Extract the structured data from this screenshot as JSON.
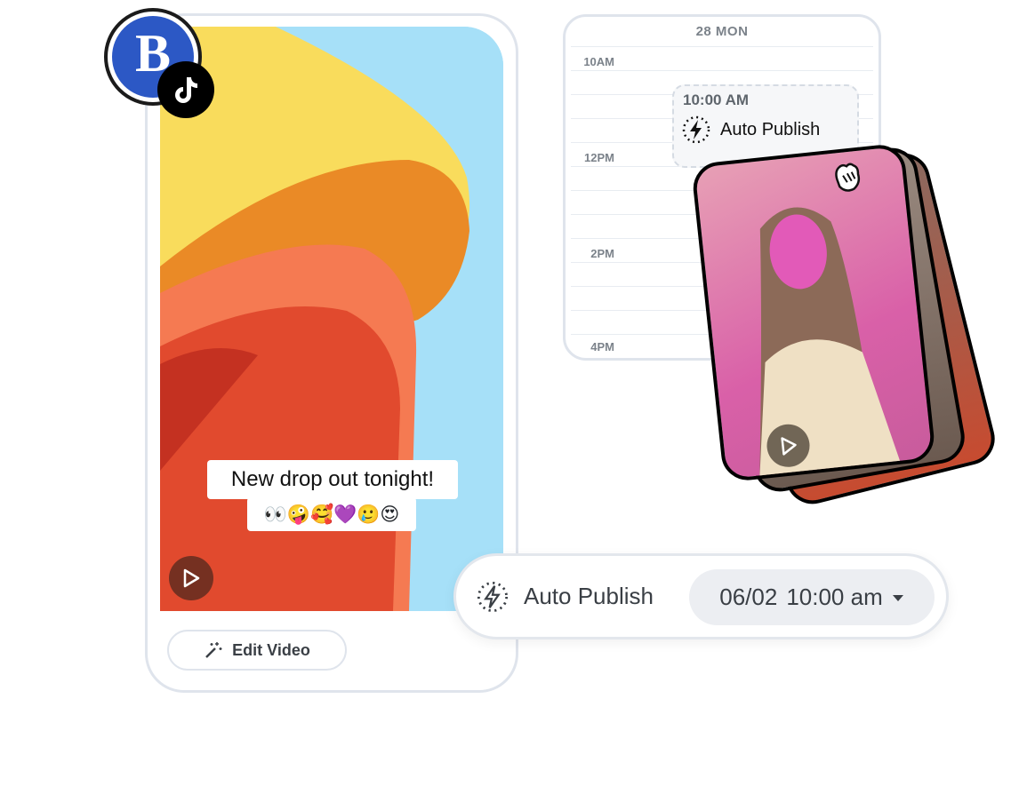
{
  "profile": {
    "avatar_letter": "B",
    "avatar_color": "#2c58c5",
    "platform_icon": "tiktok-icon"
  },
  "video": {
    "caption_line1": "New drop out tonight!",
    "caption_line2": "👀🤪🥰💜🥲😍",
    "play_icon": "play-icon"
  },
  "edit_button": {
    "label": "Edit Video",
    "icon": "magic-wand-icon"
  },
  "calendar": {
    "day_header": "28 MON",
    "times": [
      "10AM",
      "12PM",
      "2PM",
      "4PM"
    ],
    "event": {
      "time": "10:00 AM",
      "label": "Auto Publish",
      "icon": "auto-publish-bolt-icon"
    }
  },
  "preview_card": {
    "icon": "hand-wave-icon",
    "play_icon": "play-icon"
  },
  "publish_bar": {
    "label": "Auto Publish",
    "icon": "auto-publish-bolt-icon",
    "date": "06/02",
    "time": "10:00 am",
    "dropdown_icon": "caret-down-icon"
  }
}
